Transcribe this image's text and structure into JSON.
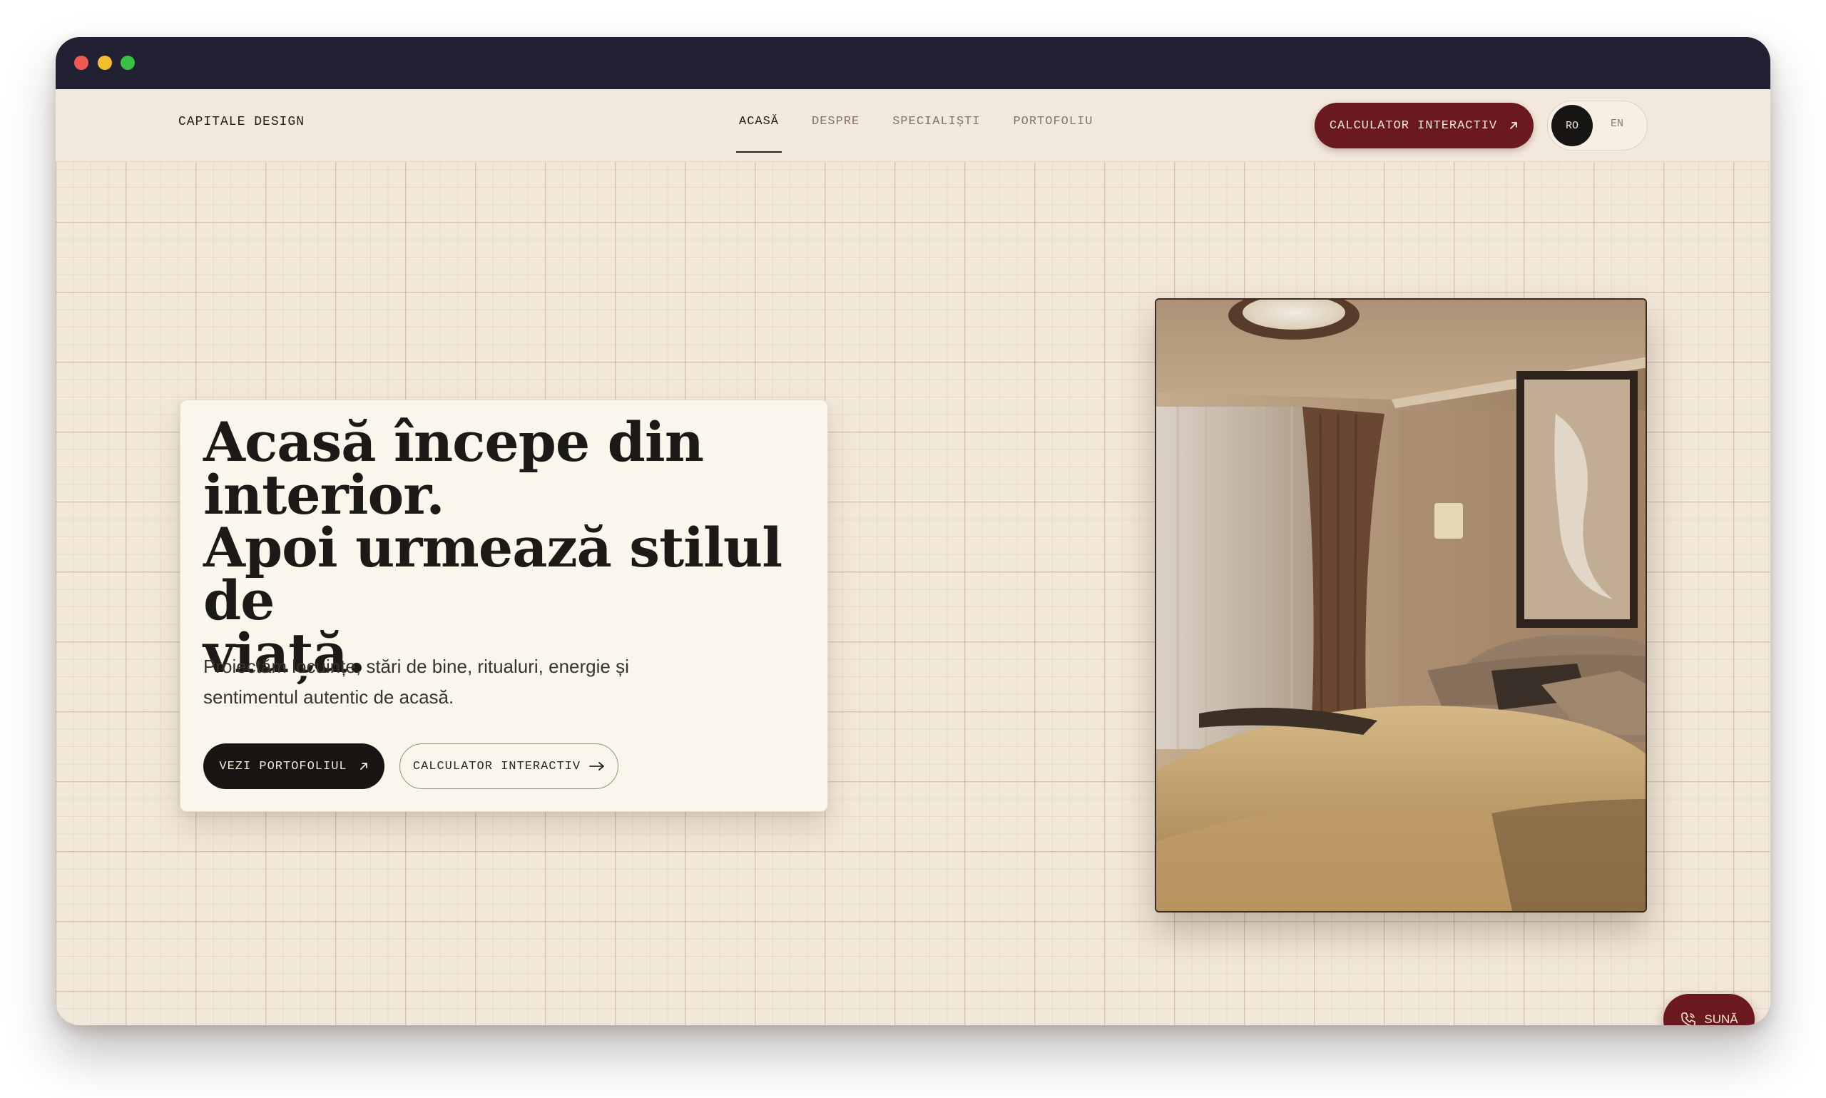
{
  "nav": {
    "brand": "CAPITALE DESIGN",
    "links": [
      "ACASĂ",
      "DESPRE",
      "SPECIALIȘTI",
      "PORTOFOLIU"
    ],
    "active_link": "ACASĂ",
    "cta_label": "CALCULATOR INTERACTIV",
    "lang_active": "RO",
    "lang_other": "EN"
  },
  "hero": {
    "title_lines": [
      "Acasă începe din",
      "interior.",
      "Apoi urmează stilul de",
      "viață."
    ],
    "subtitle_lines": [
      "Proiectăm locuințe, stări de bine, ritualuri, energie și",
      "sentimentul autentic de acasă."
    ],
    "primary_button": "VEZI PORTOFOLIUL",
    "secondary_button": "CALCULATOR INTERACTIV"
  },
  "floating": {
    "call_label": "SUNĂ"
  },
  "colors": {
    "accent": "#6a1a1e",
    "dark": "#171412",
    "background": "#f2e8d9",
    "card": "#faf6ec"
  }
}
